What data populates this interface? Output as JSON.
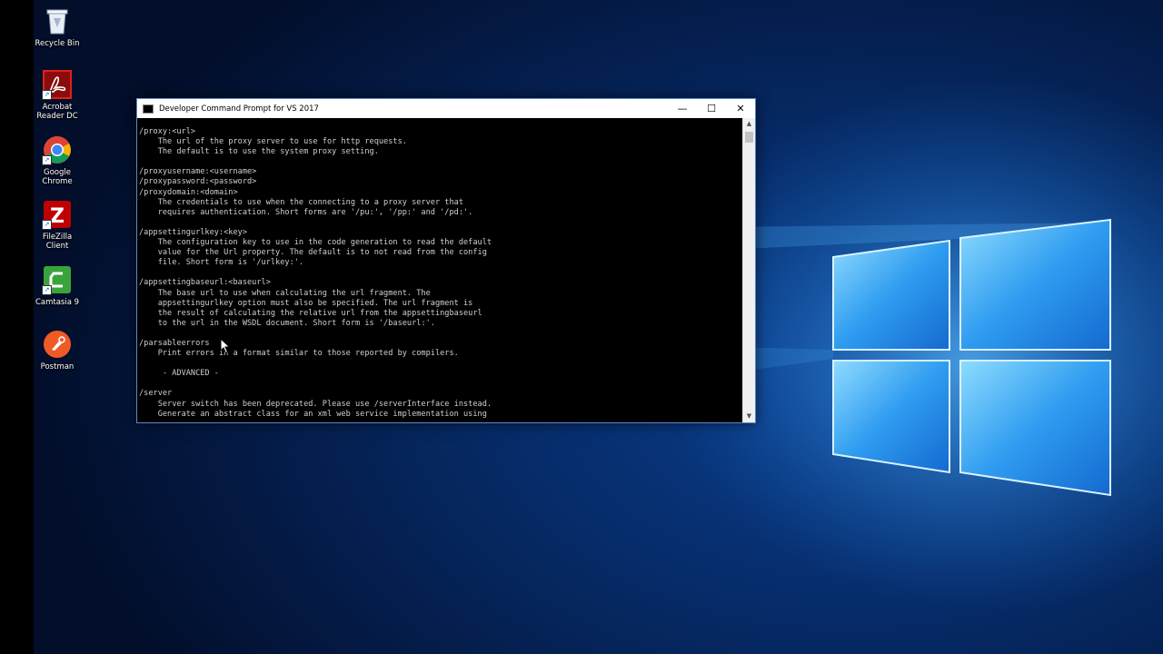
{
  "desktop_icons": [
    {
      "id": "recycle-bin",
      "label": "Recycle Bin",
      "icon": "recycle-bin-icon"
    },
    {
      "id": "acrobat",
      "label": "Acrobat\nReader DC",
      "icon": "acrobat-icon"
    },
    {
      "id": "chrome",
      "label": "Google\nChrome",
      "icon": "chrome-icon"
    },
    {
      "id": "filezilla",
      "label": "FileZilla\nClient",
      "icon": "filezilla-icon"
    },
    {
      "id": "camtasia",
      "label": "Camtasia 9",
      "icon": "camtasia-icon"
    },
    {
      "id": "postman",
      "label": "Postman",
      "icon": "postman-icon"
    }
  ],
  "window": {
    "title": "Developer Command Prompt for VS 2017",
    "minimize": "—",
    "maximize": "☐",
    "close": "✕"
  },
  "console_lines": [
    "/proxy:<url>",
    "    The url of the proxy server to use for http requests.",
    "    The default is to use the system proxy setting.",
    "",
    "/proxyusername:<username>",
    "/proxypassword:<password>",
    "/proxydomain:<domain>",
    "    The credentials to use when the connecting to a proxy server that",
    "    requires authentication. Short forms are '/pu:', '/pp:' and '/pd:'.",
    "",
    "/appsettingurlkey:<key>",
    "    The configuration key to use in the code generation to read the default",
    "    value for the Url property. The default is to not read from the config",
    "    file. Short form is '/urlkey:'.",
    "",
    "/appsettingbaseurl:<baseurl>",
    "    The base url to use when calculating the url fragment. The",
    "    appsettingurlkey option must also be specified. The url fragment is",
    "    the result of calculating the relative url from the appsettingbaseurl",
    "    to the url in the WSDL document. Short form is '/baseurl:'.",
    "",
    "/parsableerrors",
    "    Print errors in a format similar to those reported by compilers.",
    "",
    "     - ADVANCED -",
    "",
    "/server",
    "    Server switch has been deprecated. Please use /serverInterface instead.",
    "    Generate an abstract class for an xml web service implementation using"
  ],
  "colors": {
    "desktop_blue": "#0a3f8f",
    "console_bg": "#000000",
    "console_text": "#cfcfcf",
    "window_border": "#5b88c4"
  }
}
